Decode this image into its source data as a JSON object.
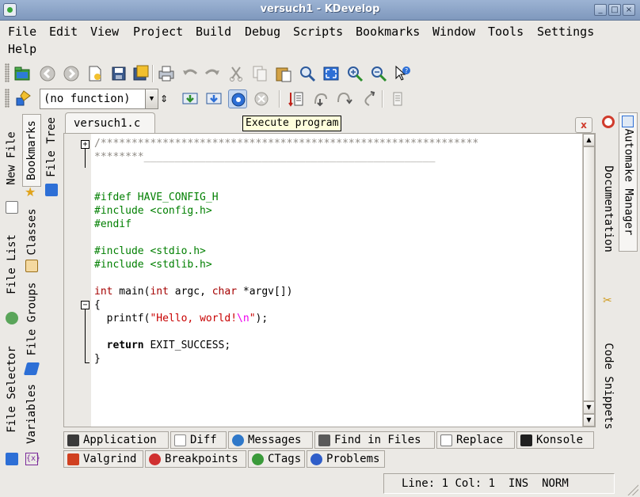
{
  "window": {
    "title": "versuch1 - KDevelop",
    "buttons": {
      "minimize": "_",
      "maximize": "□",
      "close": "×"
    }
  },
  "menu": [
    {
      "label": "File",
      "name": "menu-file"
    },
    {
      "label": "Edit",
      "name": "menu-edit"
    },
    {
      "label": "View",
      "name": "menu-view"
    },
    {
      "label": "Project",
      "name": "menu-project"
    },
    {
      "label": "Build",
      "name": "menu-build"
    },
    {
      "label": "Debug",
      "name": "menu-debug"
    },
    {
      "label": "Scripts",
      "name": "menu-scripts"
    },
    {
      "label": "Bookmarks",
      "name": "menu-bookmarks"
    },
    {
      "label": "Window",
      "name": "menu-window"
    },
    {
      "label": "Tools",
      "name": "menu-tools"
    },
    {
      "label": "Settings",
      "name": "menu-settings"
    },
    {
      "label": "Help",
      "name": "menu-help"
    }
  ],
  "toolbar2": {
    "function_combo": "(no function)",
    "combo_arrow": "▼"
  },
  "tooltip": "Execute program",
  "left_tabs_outer": [
    "New File",
    "File List",
    "File Selector"
  ],
  "left_tabs_inner": [
    "Bookmarks",
    "Classes",
    "File Groups",
    "Variables"
  ],
  "left_tabs_third": [
    "File Tree"
  ],
  "right_tabs": [
    "Documentation",
    "Code Snippets"
  ],
  "right_tabs_outer": [
    "Automake Manager"
  ],
  "editor": {
    "tab_label": "versuch1.c",
    "close_label": "x",
    "fold_plus": "+",
    "fold_minus": "−",
    "lines": [
      {
        "t": "comment",
        "v": "/*************************************************************"
      },
      {
        "t": "comment",
        "v": "********_______________________________________________"
      },
      {
        "t": "plain",
        "v": ""
      },
      {
        "t": "plain",
        "v": ""
      },
      {
        "t": "pre",
        "v": "#ifdef HAVE_CONFIG_H"
      },
      {
        "t": "pre",
        "v": "#include <config.h>"
      },
      {
        "t": "pre",
        "v": "#endif"
      },
      {
        "t": "plain",
        "v": ""
      },
      {
        "t": "pre",
        "v": "#include <stdio.h>"
      },
      {
        "t": "pre",
        "v": "#include <stdlib.h>"
      },
      {
        "t": "plain",
        "v": ""
      },
      {
        "t": "main",
        "a": "int",
        "b": " main(",
        "c": "int",
        "d": " argc, ",
        "e": "char",
        "f": " *argv[])"
      },
      {
        "t": "plain",
        "v": "{"
      },
      {
        "t": "printf",
        "a": "  printf(",
        "b": "\"Hello, world!",
        "c": "\\n",
        "d": "\"",
        "e": ");"
      },
      {
        "t": "plain",
        "v": ""
      },
      {
        "t": "ret",
        "a": "  ",
        "b": "return",
        "c": " EXIT_SUCCESS;"
      },
      {
        "t": "plain",
        "v": "}"
      }
    ]
  },
  "bottom_tabs_row1": [
    {
      "label": "Application",
      "name": "tab-application",
      "color": "#3a3a3a"
    },
    {
      "label": "Diff",
      "name": "tab-diff",
      "color": "#8a8a8a"
    },
    {
      "label": "Messages",
      "name": "tab-messages",
      "color": "#2f78c9"
    },
    {
      "label": "Find in Files",
      "name": "tab-find-in-files",
      "color": "#5a5a5a"
    },
    {
      "label": "Replace",
      "name": "tab-replace",
      "color": "#7a7a7a"
    },
    {
      "label": "Konsole",
      "name": "tab-konsole",
      "color": "#202020"
    }
  ],
  "bottom_tabs_row2": [
    {
      "label": "Valgrind",
      "name": "tab-valgrind",
      "color": "#d04020"
    },
    {
      "label": "Breakpoints",
      "name": "tab-breakpoints",
      "color": "#d03030"
    },
    {
      "label": "CTags",
      "name": "tab-ctags",
      "color": "#3a9a3a"
    },
    {
      "label": "Problems",
      "name": "tab-problems",
      "color": "#2f5ec9"
    }
  ],
  "status": {
    "line_label": "Line:",
    "line": "1",
    "col_label": "Col:",
    "col": "1",
    "mode1": "INS",
    "mode2": "NORM"
  },
  "icons": {
    "toolbar1": [
      "open-project-icon",
      "back-icon",
      "forward-icon",
      "new-file-icon",
      "save-icon",
      "save-all-icon",
      "print-icon",
      "undo-icon",
      "redo-icon",
      "cut-icon",
      "copy-icon",
      "paste-icon",
      "find-icon",
      "fullscreen-icon",
      "zoom-in-icon",
      "zoom-out-icon",
      "whats-this-icon"
    ],
    "toolbar2": [
      "class-browser-icon",
      "build-icon",
      "install-icon",
      "execute-icon",
      "stop-icon",
      "bookmark-icon",
      "step-into-icon",
      "step-over-icon",
      "step-out-icon",
      "memory-view-icon"
    ]
  }
}
